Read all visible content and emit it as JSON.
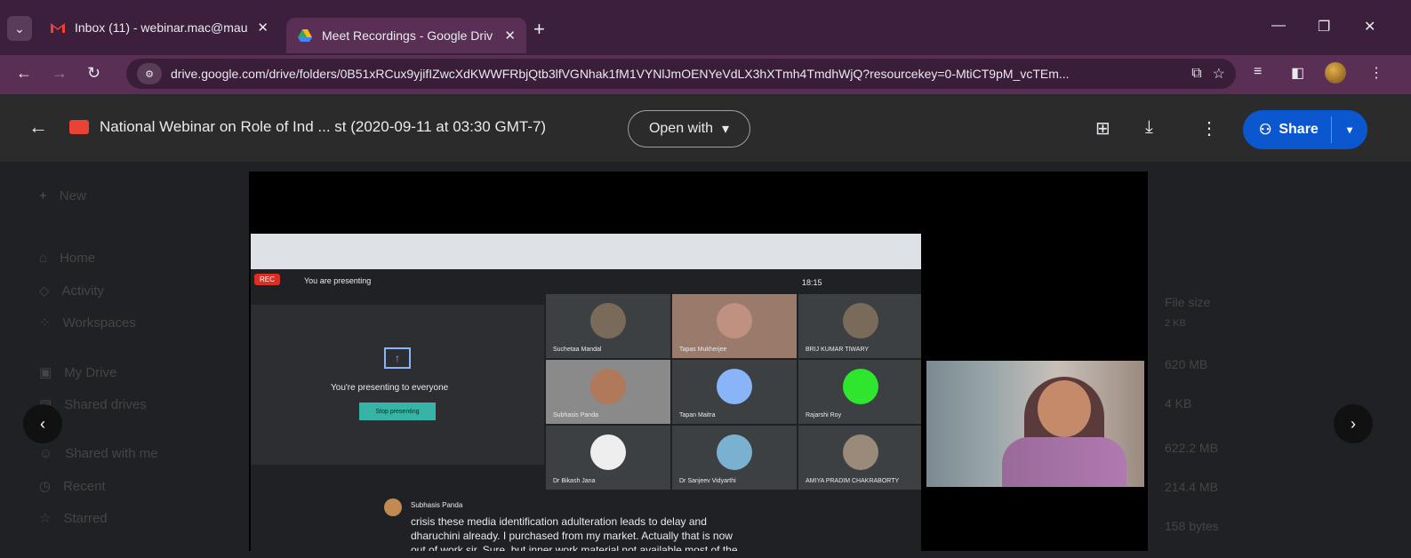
{
  "tabs": [
    {
      "title": "Inbox (11) - webinar.mac@mau",
      "icon": "gmail-icon"
    },
    {
      "title": "Meet Recordings - Google Driv",
      "icon": "drive-icon",
      "active": true
    }
  ],
  "address": {
    "url": "drive.google.com/drive/folders/0B51xRCux9yjifIZwcXdKWWFRbjQtb3lfVGNhak1fM1VYNlJmOENYeVdLX3hXTmh4TmdhWjQ?resourcekey=0-MtiCT9pM_vcTEm..."
  },
  "viewer": {
    "file_title": "National Webinar on Role of Ind ... st (2020-09-11 at 03:30 GMT-7)",
    "open_with_label": "Open with",
    "share_label": "Share"
  },
  "sidebar_bg": {
    "new_label": "New",
    "items": [
      "Home",
      "Activity",
      "Workspaces",
      "My Drive",
      "Shared drives",
      "Shared with me",
      "Recent",
      "Starred"
    ]
  },
  "list_bg": {
    "col_header": "File size",
    "sizes": [
      "2 KB",
      "620 MB",
      "4 KB",
      "622.2 MB",
      "214.4 MB",
      "158 bytes"
    ]
  },
  "meet": {
    "rec_label": "REC",
    "presenting_label": "You are presenting",
    "presenting_everyone": "You're presenting to everyone",
    "stop_label": "Stop presenting",
    "time": "18:15",
    "participants": [
      {
        "name": "Suchetaa Mandal"
      },
      {
        "name": "Tapas Mukherjee"
      },
      {
        "name": "BRIJ KUMAR TIWARY"
      },
      {
        "name": "Subhasis Panda"
      },
      {
        "name": "Tapan Maitra"
      },
      {
        "name": "Rajarshi Roy"
      },
      {
        "name": "Dr Bikash Jana"
      },
      {
        "name": "Dr Sanjeev Vidyarthi"
      },
      {
        "name": "AMIYA PRADIM CHAKRABORTY"
      }
    ],
    "caption_name": "Subhasis Panda",
    "caption_lines": [
      "crisis these media identification adulteration leads to delay and",
      "dharuchini already. I purchased from my market. Actually that is now",
      "out of work sir. Sure, but inner work material not available most of the"
    ]
  },
  "colors": {
    "share": "#0b57d0",
    "tab_bar": "#3c1f3c",
    "address_bar": "#5a2f55"
  }
}
